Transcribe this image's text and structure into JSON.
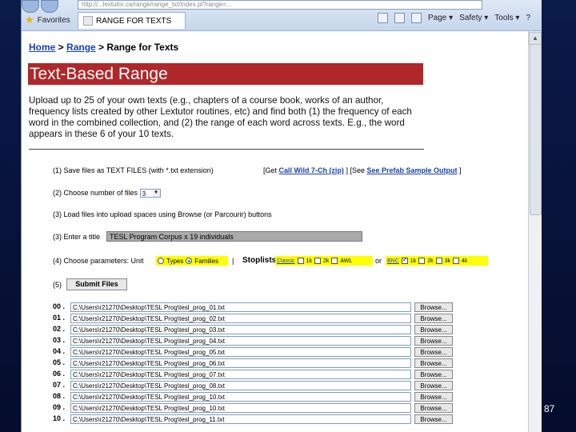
{
  "browser": {
    "address": "http://...lextutor.ca/range/range_txt/index.pl?range=...",
    "favorites_label": "Favorites",
    "tab_title": "RANGE FOR TEXTS",
    "command_items": [
      "Page ▾",
      "Safety ▾",
      "Tools ▾",
      "?"
    ]
  },
  "breadcrumb": {
    "home": "Home",
    "sep1": " > ",
    "range": "Range",
    "sep2": " > ",
    "current": "Range for Texts"
  },
  "page_title": "Text-Based Range",
  "description": "Upload up to 25 of your own texts (e.g., chapters of a course book, works of an author, frequency lists created by other Lextutor routines, etc) and find both (1) the frequency of each word in the combined collection, and (2) the range of each word across texts. E.g., the word appears in these 6 of your 10 texts.",
  "step1": {
    "text": "(1) Save files as TEXT FILES (with *.txt extension)",
    "get_prefix": "[Get ",
    "get_link": "Call Wild 7-Ch (zip)",
    "mid": " ]   [See ",
    "see_link": "See Prefab Sample Output",
    "suffix": " ]"
  },
  "step2": {
    "text": "(2) Choose number of files",
    "value": "3"
  },
  "step3": {
    "text": "(3) Load files into upload spaces using Browse (or Parcourir) buttons"
  },
  "step4": {
    "text": "(3) Enter a title",
    "title_value": "TESL Program Corpus x 19 individuals"
  },
  "step5": {
    "text": "(4) Choose parameters: Unit",
    "unit_types": "Types",
    "unit_families": "Families",
    "sep": "|",
    "stoplists_label": "Stoplists",
    "classic": "Classic",
    "classic_opts": [
      "1k",
      "2k",
      "AWL"
    ],
    "or": "or",
    "bnc": "BNC",
    "bnc_opts": [
      "1k",
      "2k",
      "3k",
      "4k"
    ]
  },
  "step6": {
    "text": "(5)",
    "submit": "Submit Files"
  },
  "files": [
    {
      "num": "00 .",
      "path": "C:\\Users\\r21270\\Desktop\\TESL Prog\\tesl_prog_01.txt"
    },
    {
      "num": "01 .",
      "path": "C:\\Users\\r21270\\Desktop\\TESL Prog\\tesl_prog_02.txt"
    },
    {
      "num": "02 .",
      "path": "C:\\Users\\r21270\\Desktop\\TESL Prog\\tesl_prog_03.txt"
    },
    {
      "num": "03 .",
      "path": "C:\\Users\\r21270\\Desktop\\TESL Prog\\tesl_prog_04.txt"
    },
    {
      "num": "04 .",
      "path": "C:\\Users\\r21270\\Desktop\\TESL Prog\\tesl_prog_05.txt"
    },
    {
      "num": "05 .",
      "path": "C:\\Users\\r21270\\Desktop\\TESL Prog\\tesl_prog_06.txt"
    },
    {
      "num": "06 .",
      "path": "C:\\Users\\r21270\\Desktop\\TESL Prog\\tesl_prog_07.txt"
    },
    {
      "num": "07 .",
      "path": "C:\\Users\\r21270\\Desktop\\TESL Prog\\tesl_prog_08.txt"
    },
    {
      "num": "08 .",
      "path": "C:\\Users\\r21270\\Desktop\\TESL Prog\\tesl_prog_10.txt"
    },
    {
      "num": "09 .",
      "path": "C:\\Users\\r21270\\Desktop\\TESL Prog\\tesl_prog_10.txt"
    },
    {
      "num": "10 .",
      "path": "C:\\Users\\r21270\\Desktop\\TESL Prog\\tesl_prog_11.txt"
    }
  ],
  "browse_label": "Browse...",
  "slide_number": "87",
  "colors": {
    "title_bg": "#b0272a",
    "link": "#1a3fb0",
    "highlight": "#ffff00"
  }
}
